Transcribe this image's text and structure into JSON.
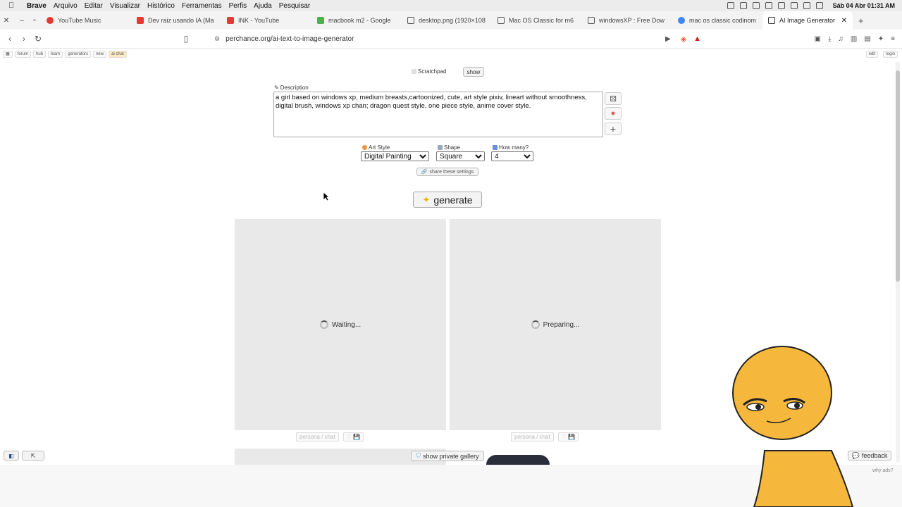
{
  "menubar": {
    "app": "Brave",
    "items": [
      "Arquivo",
      "Editar",
      "Visualizar",
      "Histórico",
      "Ferramentas",
      "Perfis",
      "Ajuda",
      "Pesquisar"
    ],
    "clock": "Sáb 04 Abr 01:31 AM"
  },
  "tabs": [
    {
      "label": "YouTube Music",
      "color": "#e53935"
    },
    {
      "label": "Dev raiz usando IA (Ma",
      "color": "#e53935"
    },
    {
      "label": "INK - YouTube",
      "color": "#e53935"
    },
    {
      "label": "macbook m2 - Google",
      "color": "#4caf50"
    },
    {
      "label": "desktop.png (1920×108",
      "color": "#555555"
    },
    {
      "label": "Mac OS Classic for m6",
      "color": "#555555"
    },
    {
      "label": "windowsXP : Free Dow",
      "color": "#555555"
    },
    {
      "label": "mac os classic codinom",
      "color": "#4285f4"
    },
    {
      "label": "AI Image Generator",
      "color": "#333333"
    }
  ],
  "address": {
    "url": "perchance.org/ai-text-to-image-generator"
  },
  "pbar": {
    "left": [
      "forum",
      "hub",
      "learn",
      "generators",
      "new",
      "ai chat"
    ],
    "right": [
      "edit",
      "login"
    ]
  },
  "scratchpad": {
    "label": "Scratchpad",
    "show": "show"
  },
  "description": {
    "label": "Description",
    "text": "a girl based on windows xp, medium breasts,cartoonized, cute, art style pixiv, lineart without smoothness, digital brush, windows xp chan; dragon quest style, one piece style, anime cover style."
  },
  "settings": {
    "art_style_label": "Art Style",
    "art_style": "Digital Painting",
    "shape_label": "Shape",
    "shape": "Square",
    "how_many_label": "How many?",
    "how_many": "4",
    "share": "share these settings"
  },
  "generate": "generate",
  "panels": [
    {
      "status": "Waiting..."
    },
    {
      "status": "Preparing..."
    }
  ],
  "panel_controls": {
    "persona": "persona / chat",
    "save": "♡ 💾"
  },
  "bottom": {
    "private_gallery": "show private gallery",
    "feedback": "feedback",
    "why_ads": "why ads?"
  }
}
